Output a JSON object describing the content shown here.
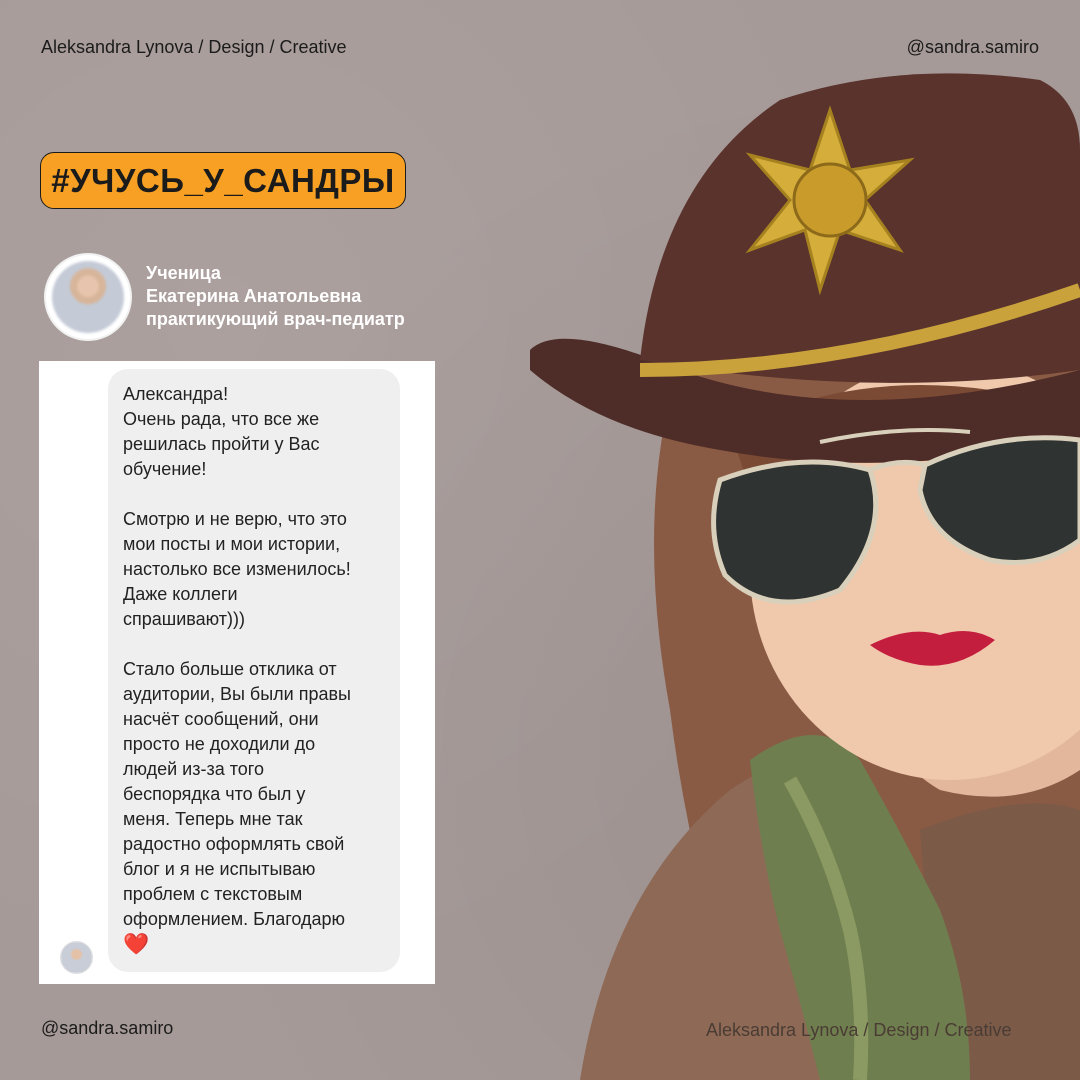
{
  "header": {
    "left_text": "Aleksandra Lynova / Design / Creative",
    "right_text": "@sandra.samiro"
  },
  "hashtag_label": "#УЧУСЬ_У_САНДРЫ",
  "student": {
    "role": "Ученица",
    "name": "Екатерина Анатольевна",
    "profession": "практикующий врач-педиатр"
  },
  "message": {
    "paragraph1_line1": "Александра!",
    "paragraph1_line2": "Очень рада, что все же",
    "paragraph1_line3": "решилась пройти у Вас",
    "paragraph1_line4": "обучение!",
    "paragraph2_line1": "Смотрю и не верю, что это",
    "paragraph2_line2": "мои посты и мои истории,",
    "paragraph2_line3": "настолько все изменилось!",
    "paragraph2_line4": "Даже коллеги",
    "paragraph2_line5": "спрашивают)))",
    "paragraph3_line1": "Стало больше отклика от",
    "paragraph3_line2": "аудитории, Вы были правы",
    "paragraph3_line3": "насчёт сообщений, они",
    "paragraph3_line4": "просто не доходили до",
    "paragraph3_line5": "людей из-за того",
    "paragraph3_line6": "беспорядка что был у",
    "paragraph3_line7": "меня. Теперь мне так",
    "paragraph3_line8": "радостно оформлять свой",
    "paragraph3_line9": "блог и я не испытываю",
    "paragraph3_line10": "проблем с текстовым",
    "paragraph3_line11": "оформлением. Благодарю",
    "heart": "❤️"
  },
  "footer": {
    "left_text": "@sandra.samiro",
    "right_text": "Aleksandra Lynova / Design / Creative"
  },
  "colors": {
    "background": "#a69a98",
    "hashtag_bg": "#f7a023",
    "hat": "#4e2c28",
    "lips": "#c41e3f"
  }
}
